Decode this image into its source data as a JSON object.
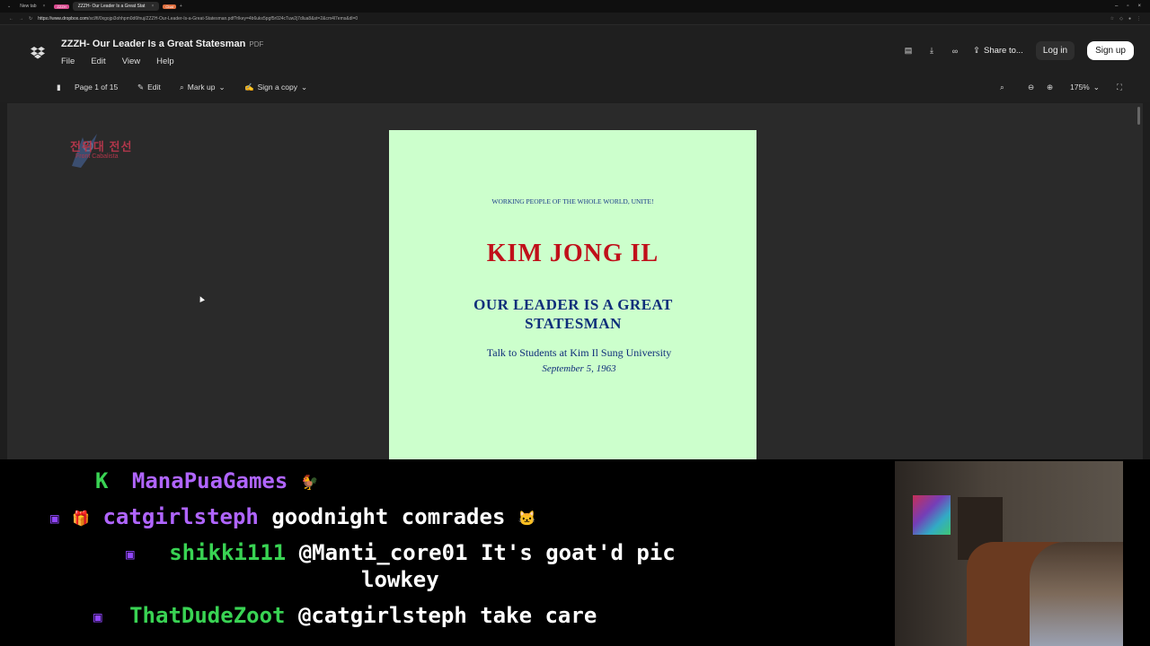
{
  "browser": {
    "tabs": [
      {
        "label": "New tab"
      },
      {
        "label": "ZZZH- Our Leader Is a Great Stat",
        "badge": "ZZZH"
      },
      {
        "label": "",
        "badge": "Chat"
      }
    ],
    "url_host": "https://www.dropbox.com",
    "url_rest": "/scl/fi/0xgojpi3ohhpm0d6fnuj/ZZZH-Our-Leader-Is-a-Great-Statesman.pdf?rlkey=4b6ukx5pgf5r024cTuw2j7dlua8&st=2&cm4l7ems&dl=0"
  },
  "header": {
    "title": "ZZZH- Our Leader Is a Great Statesman",
    "type": "PDF",
    "menu": [
      "File",
      "Edit",
      "View",
      "Help"
    ],
    "share_label": "Share to...",
    "login_label": "Log in",
    "signup_label": "Sign up"
  },
  "toolbar": {
    "page_info": "Page 1 of 15",
    "edit_label": "Edit",
    "markup_label": "Mark up",
    "sign_label": "Sign a copy",
    "zoom": "175%"
  },
  "watermark": {
    "korean": "전위대 전선",
    "latin": "Front Cabalista"
  },
  "pdf_page": {
    "slogan": "WORKING PEOPLE OF THE WHOLE WORLD, UNITE!",
    "author": "KIM JONG IL",
    "title": "OUR LEADER IS A GREAT STATESMAN",
    "subtitle": "Talk to Students at Kim Il Sung University",
    "date": "September 5, 1963"
  },
  "chat": {
    "messages": [
      {
        "user": "ManaPuaGames",
        "text": "",
        "user_color": "#b065ff",
        "badges": "K"
      },
      {
        "user": "catgirlsteph",
        "text": "goodnight comrades",
        "user_color": "#b065ff"
      },
      {
        "user": "shikki111",
        "text": "@Manti_core01 It's goat'd pic",
        "text2": "lowkey",
        "user_color": "#39d353"
      },
      {
        "user": "ThatDudeZoot",
        "text": "@catgirlsteph take care",
        "user_color": "#39d353"
      }
    ]
  },
  "colors": {
    "pdf_background": "#ccffcc",
    "author_red": "#c0101a",
    "title_blue": "#0f2e7a",
    "chat_purple": "#b065ff",
    "chat_green": "#39d353"
  }
}
